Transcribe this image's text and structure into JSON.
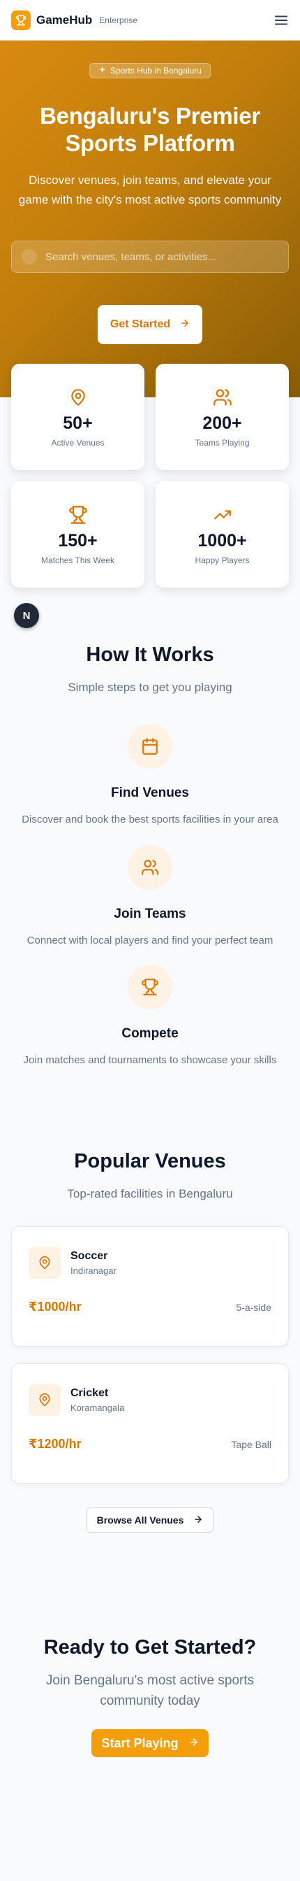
{
  "nav": {
    "brand": "GameHub",
    "edition": "Enterprise"
  },
  "hero": {
    "badge": "Sports Hub in Bengaluru",
    "title": "Bengaluru's Premier Sports Platform",
    "subtitle": "Discover venues, join teams, and elevate your game with the city's most active sports community",
    "search_placeholder": "Search venues, teams, or activities...",
    "cta_label": "Get Started"
  },
  "stats": [
    {
      "icon": "map-pin-icon",
      "value": "50+",
      "label": "Active Venues"
    },
    {
      "icon": "users-icon",
      "value": "200+",
      "label": "Teams Playing"
    },
    {
      "icon": "trophy-icon",
      "value": "150+",
      "label": "Matches This Week"
    },
    {
      "icon": "trending-up-icon",
      "value": "1000+",
      "label": "Happy Players"
    }
  ],
  "floating_avatar": "N",
  "how": {
    "title": "How It Works",
    "subtitle": "Simple steps to get you playing",
    "steps": [
      {
        "icon": "calendar-icon",
        "title": "Find Venues",
        "desc": "Discover and book the best sports facilities in your area"
      },
      {
        "icon": "users-icon",
        "title": "Join Teams",
        "desc": "Connect with local players and find your perfect team"
      },
      {
        "icon": "trophy-icon",
        "title": "Compete",
        "desc": "Join matches and tournaments to showcase your skills"
      }
    ]
  },
  "venues": {
    "title": "Popular Venues",
    "subtitle": "Top-rated facilities in Bengaluru",
    "items": [
      {
        "name": "Soccer",
        "location": "Indiranagar",
        "price": "₹1000/hr",
        "type": "5-a-side"
      },
      {
        "name": "Cricket",
        "location": "Koramangala",
        "price": "₹1200/hr",
        "type": "Tape Ball"
      }
    ],
    "browse_label": "Browse All Venues"
  },
  "ready": {
    "title": "Ready to Get Started?",
    "subtitle": "Join Bengaluru's most active sports community today",
    "cta_label": "Start Playing"
  },
  "colors": {
    "accent": "#f59e0b",
    "accent_dark": "#d97706",
    "text": "#0f172a",
    "muted": "#64748b"
  }
}
